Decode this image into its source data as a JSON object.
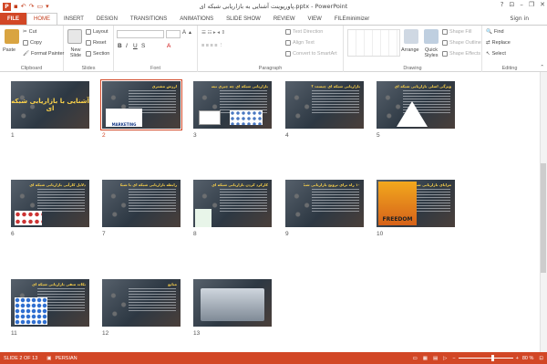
{
  "window": {
    "title": "پاورپوینت آشنایی به بازاریابی شبکه ای.pptx - PowerPoint",
    "help": "?",
    "min": "–",
    "max": "❐",
    "close": "✕"
  },
  "tabs": [
    {
      "label": "FILE"
    },
    {
      "label": "HOME"
    },
    {
      "label": "INSERT"
    },
    {
      "label": "DESIGN"
    },
    {
      "label": "TRANSITIONS"
    },
    {
      "label": "ANIMATIONS"
    },
    {
      "label": "SLIDE SHOW"
    },
    {
      "label": "REVIEW"
    },
    {
      "label": "VIEW"
    },
    {
      "label": "FILEminimizer"
    }
  ],
  "signin": "Sign in",
  "ribbon": {
    "clipboard": {
      "label": "Clipboard",
      "paste": "Paste",
      "cut": "Cut",
      "copy": "Copy",
      "format_painter": "Format Painter"
    },
    "slides": {
      "label": "Slides",
      "new_slide": "New Slide",
      "layout": "Layout",
      "reset": "Reset",
      "section": "Section"
    },
    "font": {
      "label": "Font"
    },
    "paragraph": {
      "label": "Paragraph",
      "text_direction": "Text Direction",
      "align_text": "Align Text",
      "convert_smartart": "Convert to SmartArt"
    },
    "drawing": {
      "label": "Drawing",
      "arrange": "Arrange",
      "quick_styles": "Quick Styles",
      "shape_fill": "Shape Fill",
      "shape_outline": "Shape Outline",
      "shape_effects": "Shape Effects"
    },
    "editing": {
      "label": "Editing",
      "find": "Find",
      "replace": "Replace",
      "select": "Select"
    }
  },
  "slides": [
    {
      "num": "1",
      "title": "آشنایی با بازاریابی شبکه ای",
      "kind": "title"
    },
    {
      "num": "2",
      "title": "ارزش مشتری",
      "kind": "marketing",
      "picture": "MARKETING"
    },
    {
      "num": "3",
      "title": "بازاریابی شبکه ای چه چیزی نیست ؟",
      "kind": "question"
    },
    {
      "num": "4",
      "title": "بازاریابی شبکه ای چیست ؟",
      "kind": "text"
    },
    {
      "num": "5",
      "title": "ویژگی اصلی بازاریابی شبکه ای",
      "kind": "pyramid"
    },
    {
      "num": "6",
      "title": "دلایل کارآیی بازاریابی شبکه ای",
      "kind": "people"
    },
    {
      "num": "7",
      "title": "رابطه بازاریابی شبکه ای با شبکه اینترنت",
      "kind": "text"
    },
    {
      "num": "8",
      "title": "کارکرد کردن بازاریابی شبکه ای",
      "kind": "hands"
    },
    {
      "num": "9",
      "title": "۱۰ راه برای ترویج بازاریابی شبکه ای",
      "kind": "text"
    },
    {
      "num": "10",
      "title": "مزایای بازاریابی شبکه ای",
      "kind": "freedom",
      "picture": "FREEDOM"
    },
    {
      "num": "11",
      "title": "نکات منفی بازاریابی شبکه ای",
      "kind": "crowd"
    },
    {
      "num": "12",
      "title": "منابع",
      "kind": "text"
    },
    {
      "num": "13",
      "title": "",
      "kind": "laptop"
    }
  ],
  "status": {
    "slide": "SLIDE 2 OF 13",
    "language": "PERSIAN",
    "zoom": "80 %"
  }
}
